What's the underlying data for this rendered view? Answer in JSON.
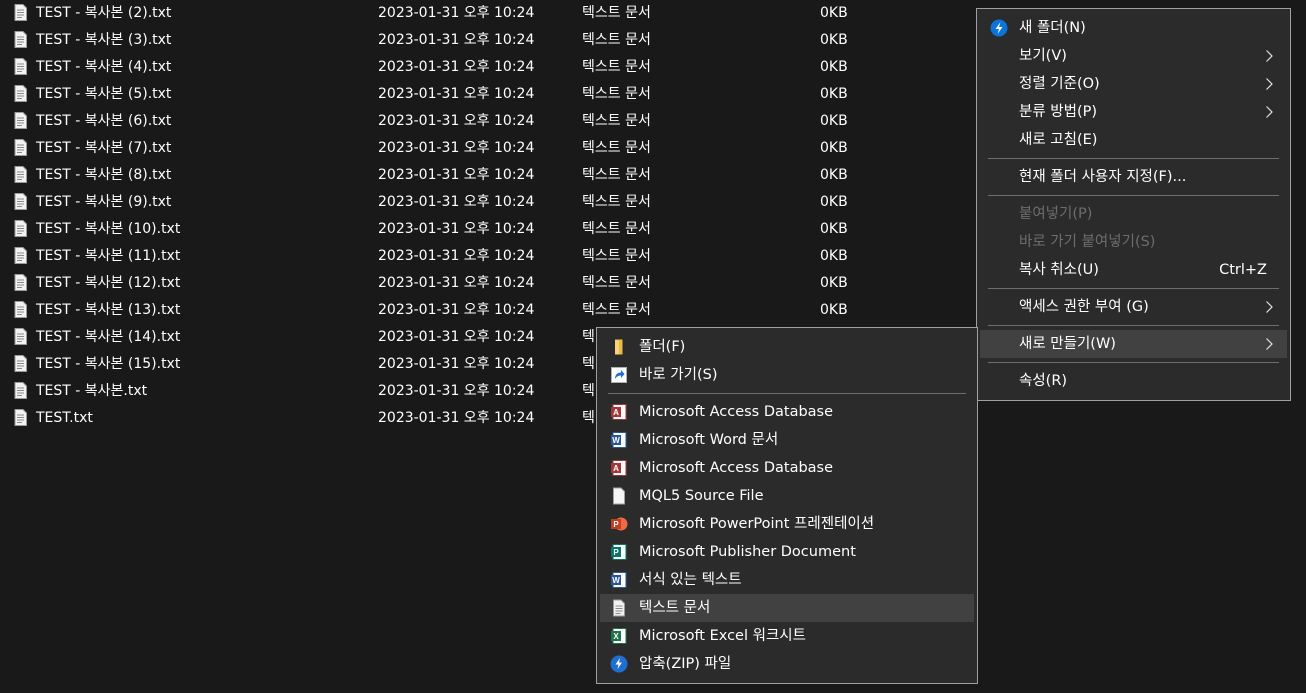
{
  "files": [
    {
      "name": "TEST - 복사본 (2).txt",
      "date": "2023-01-31 오후 10:24",
      "type": "텍스트 문서",
      "size": "0KB"
    },
    {
      "name": "TEST - 복사본 (3).txt",
      "date": "2023-01-31 오후 10:24",
      "type": "텍스트 문서",
      "size": "0KB"
    },
    {
      "name": "TEST - 복사본 (4).txt",
      "date": "2023-01-31 오후 10:24",
      "type": "텍스트 문서",
      "size": "0KB"
    },
    {
      "name": "TEST - 복사본 (5).txt",
      "date": "2023-01-31 오후 10:24",
      "type": "텍스트 문서",
      "size": "0KB"
    },
    {
      "name": "TEST - 복사본 (6).txt",
      "date": "2023-01-31 오후 10:24",
      "type": "텍스트 문서",
      "size": "0KB"
    },
    {
      "name": "TEST - 복사본 (7).txt",
      "date": "2023-01-31 오후 10:24",
      "type": "텍스트 문서",
      "size": "0KB"
    },
    {
      "name": "TEST - 복사본 (8).txt",
      "date": "2023-01-31 오후 10:24",
      "type": "텍스트 문서",
      "size": "0KB"
    },
    {
      "name": "TEST - 복사본 (9).txt",
      "date": "2023-01-31 오후 10:24",
      "type": "텍스트 문서",
      "size": "0KB"
    },
    {
      "name": "TEST - 복사본 (10).txt",
      "date": "2023-01-31 오후 10:24",
      "type": "텍스트 문서",
      "size": "0KB"
    },
    {
      "name": "TEST - 복사본 (11).txt",
      "date": "2023-01-31 오후 10:24",
      "type": "텍스트 문서",
      "size": "0KB"
    },
    {
      "name": "TEST - 복사본 (12).txt",
      "date": "2023-01-31 오후 10:24",
      "type": "텍스트 문서",
      "size": "0KB"
    },
    {
      "name": "TEST - 복사본 (13).txt",
      "date": "2023-01-31 오후 10:24",
      "type": "텍스트 문서",
      "size": "0KB"
    },
    {
      "name": "TEST - 복사본 (14).txt",
      "date": "2023-01-31 오후 10:24",
      "type": "텍",
      "size": ""
    },
    {
      "name": "TEST - 복사본 (15).txt",
      "date": "2023-01-31 오후 10:24",
      "type": "텍",
      "size": ""
    },
    {
      "name": "TEST - 복사본.txt",
      "date": "2023-01-31 오후 10:24",
      "type": "텍",
      "size": ""
    },
    {
      "name": "TEST.txt",
      "date": "2023-01-31 오후 10:24",
      "type": "텍",
      "size": ""
    }
  ],
  "context_menu": {
    "new_folder": "새 폴더(N)",
    "view": "보기(V)",
    "sort_by": "정렬 기준(O)",
    "group_by": "분류 방법(P)",
    "refresh": "새로 고침(E)",
    "customize_folder": "현재 폴더 사용자 지정(F)...",
    "paste": "붙여넣기(P)",
    "paste_shortcut": "바로 가기 붙여넣기(S)",
    "undo_copy": "복사 취소(U)",
    "undo_copy_shortcut": "Ctrl+Z",
    "give_access": "액세스 권한 부여 (G)",
    "new": "새로 만들기(W)",
    "properties": "속성(R)"
  },
  "new_submenu": {
    "folder": "폴더(F)",
    "shortcut": "바로 가기(S)",
    "access_db_1": "Microsoft Access Database",
    "word_doc": "Microsoft Word 문서",
    "access_db_2": "Microsoft Access Database",
    "mql5": "MQL5 Source File",
    "powerpoint": "Microsoft PowerPoint 프레젠테이션",
    "publisher": "Microsoft Publisher Document",
    "rich_text": "서식 있는 텍스트",
    "text_doc": "텍스트 문서",
    "excel": "Microsoft Excel 워크시트",
    "zip": "압축(ZIP) 파일"
  },
  "colors": {
    "background": "#191919",
    "menu_bg": "#2b2b2b",
    "highlight": "#414141",
    "disabled_text": "#6d6d6d",
    "access_red": "#a4373a",
    "word_blue": "#2b579a",
    "powerpoint_orange": "#c43e1c",
    "publisher_teal": "#077568",
    "excel_green": "#217346"
  }
}
